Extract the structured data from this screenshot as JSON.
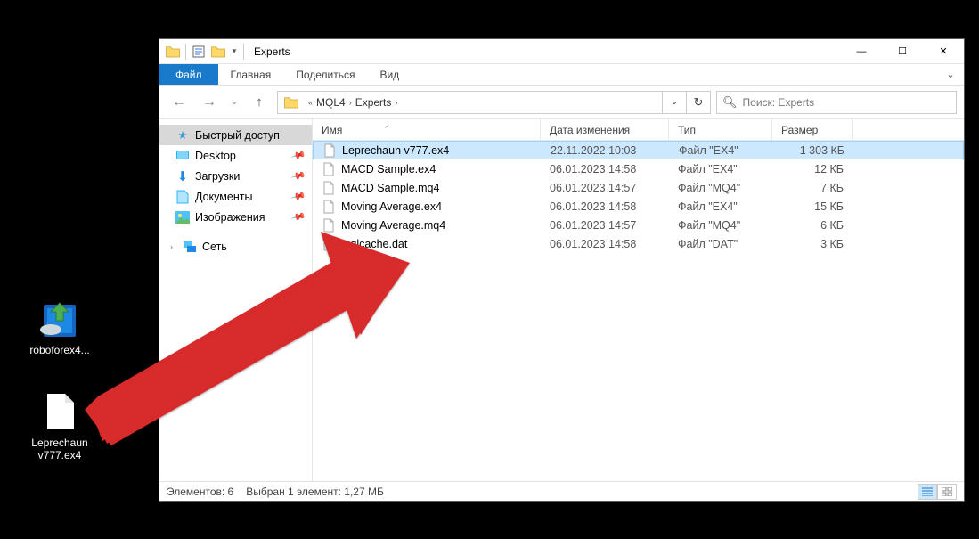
{
  "desktop": {
    "icon1_label": "roboforex4...",
    "icon2_label": "Leprechaun\nv777.ex4"
  },
  "window": {
    "title": "Experts",
    "win_min": "—",
    "win_max": "☐",
    "win_close": "✕"
  },
  "ribbon": {
    "file": "Файл",
    "main": "Главная",
    "share": "Поделиться",
    "view": "Вид"
  },
  "address": {
    "prefix": "«",
    "seg1": "MQL4",
    "seg2": "Experts",
    "search_placeholder": "Поиск: Experts"
  },
  "nav": {
    "quick": "Быстрый доступ",
    "desktop": "Desktop",
    "downloads": "Загрузки",
    "documents": "Документы",
    "pictures": "Изображения",
    "network": "Сеть"
  },
  "columns": {
    "name": "Имя",
    "date": "Дата изменения",
    "type": "Тип",
    "size": "Размер"
  },
  "files": {
    "r0": {
      "name": "Leprechaun v777.ex4",
      "date": "22.11.2022 10:03",
      "type": "Файл \"EX4\"",
      "size": "1 303 КБ"
    },
    "r1": {
      "name": "MACD Sample.ex4",
      "date": "06.01.2023 14:58",
      "type": "Файл \"EX4\"",
      "size": "12 КБ"
    },
    "r2": {
      "name": "MACD Sample.mq4",
      "date": "06.01.2023 14:57",
      "type": "Файл \"MQ4\"",
      "size": "7 КБ"
    },
    "r3": {
      "name": "Moving Average.ex4",
      "date": "06.01.2023 14:58",
      "type": "Файл \"EX4\"",
      "size": "15 КБ"
    },
    "r4": {
      "name": "Moving Average.mq4",
      "date": "06.01.2023 14:57",
      "type": "Файл \"MQ4\"",
      "size": "6 КБ"
    },
    "r5": {
      "name": "mqlcache.dat",
      "date": "06.01.2023 14:58",
      "type": "Файл \"DAT\"",
      "size": "3 КБ"
    }
  },
  "status": {
    "count": "Элементов: 6",
    "selection": "Выбран 1 элемент: 1,27 МБ"
  }
}
